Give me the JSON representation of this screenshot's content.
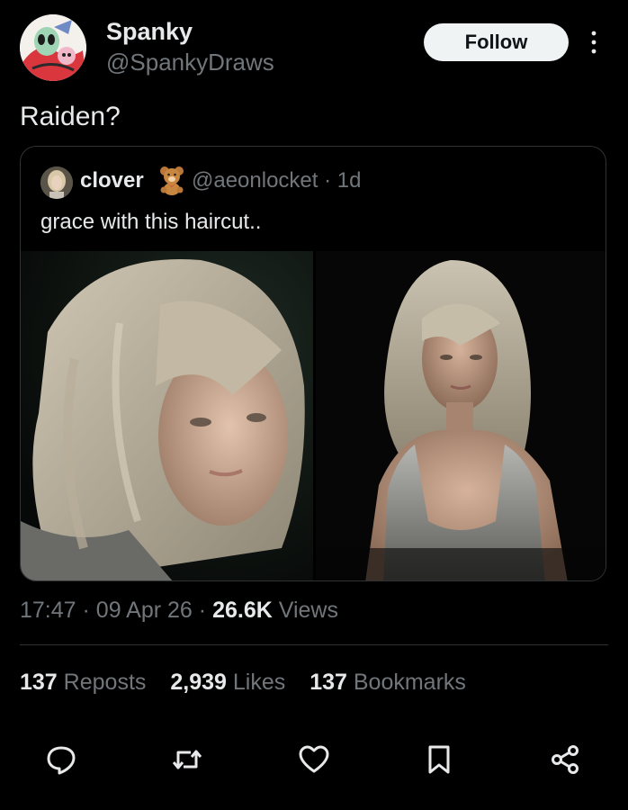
{
  "author": {
    "display_name": "Spanky",
    "handle": "@SpankyDraws"
  },
  "follow_label": "Follow",
  "post_text": "Raiden?",
  "quote": {
    "display_name": "clover",
    "handle": "@aeonlocket",
    "separator": "·",
    "age": "1d",
    "text": "grace with this haircut.."
  },
  "meta": {
    "time": "17:47",
    "date": "09 Apr 26",
    "separator": "·",
    "views_count": "26.6K",
    "views_label": "Views"
  },
  "stats": {
    "reposts_count": "137",
    "reposts_label": "Reposts",
    "likes_count": "2,939",
    "likes_label": "Likes",
    "bookmarks_count": "137",
    "bookmarks_label": "Bookmarks"
  },
  "icons": {
    "more": "more-vertical-icon",
    "reply": "reply-icon",
    "repost": "repost-icon",
    "like": "heart-icon",
    "bookmark": "bookmark-icon",
    "share": "share-icon",
    "bear": "teddy-bear-icon"
  },
  "colors": {
    "background": "#000000",
    "text_primary": "#e7e9ea",
    "text_secondary": "#71767b",
    "border": "#2f3336",
    "follow_bg": "#eff3f4"
  }
}
